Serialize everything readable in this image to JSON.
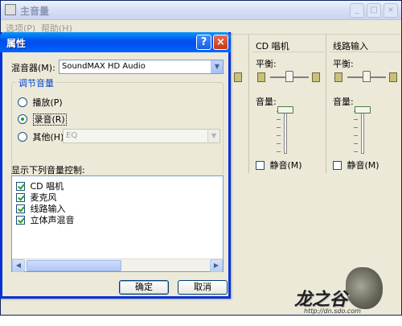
{
  "main_window": {
    "title": "主音量",
    "menu": [
      "选项(P)",
      "帮助(H)"
    ],
    "buttons": {
      "minimize": "_",
      "maximize": "□",
      "close": "×"
    }
  },
  "channels": [
    {
      "title": "CD 唱机",
      "balance_label": "平衡:",
      "volume_label": "音量:",
      "mute_label": "静音(M)",
      "mute_checked": false,
      "balance_level": 0.5,
      "volume_level": 0.93
    },
    {
      "title": "线路输入",
      "balance_label": "平衡:",
      "volume_label": "音量:",
      "mute_label": "静音(M)",
      "mute_checked": false,
      "balance_level": 0.5,
      "volume_level": 0.93
    }
  ],
  "dialog": {
    "title": "属性",
    "help_button": "?",
    "close_button": "×",
    "mixer_label": "混音器(M):",
    "mixer_value": "SoundMAX HD Audio",
    "group_title": "调节音量",
    "radios": [
      {
        "label": "播放(P)",
        "checked": false
      },
      {
        "label": "录音(R)",
        "checked": true
      },
      {
        "label": "其他(H)",
        "checked": false
      }
    ],
    "other_combo_value": "EQ",
    "list_label": "显示下列音量控制:",
    "list_items": [
      {
        "label": "CD 唱机",
        "checked": true
      },
      {
        "label": "麦克风",
        "checked": true
      },
      {
        "label": "线路输入",
        "checked": true
      },
      {
        "label": "立体声混音",
        "checked": true
      }
    ],
    "ok_button": "确定",
    "cancel_button": "取消"
  },
  "watermark": {
    "logo_text": "龙之谷",
    "url": "http://dn.sdo.com"
  },
  "colors": {
    "dialog_title_blue": "#0053ee",
    "xp_face": "#ece9d8",
    "check_green": "#21a121",
    "group_title_blue": "#0046d5"
  }
}
